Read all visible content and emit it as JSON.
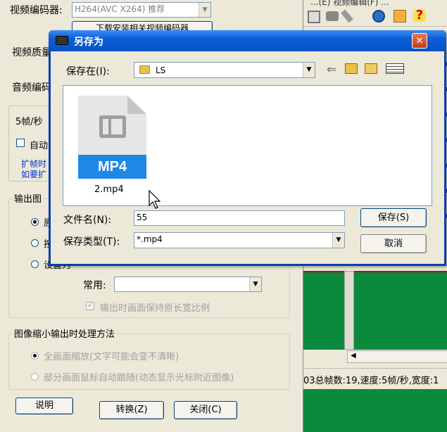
{
  "left_panel": {
    "video_codec_label": "视频编码器:",
    "video_codec_value": "H264(AVC X264) 推荐",
    "download_codec_button": "下载安装相关视频编码器",
    "video_quality_label": "视频质量",
    "audio_codec_label": "音频编码",
    "fps_label": "5帧/秒",
    "auto_checkbox_label": "自动",
    "expand_line1": "扩帧时",
    "expand_line2": "如要扩",
    "output_group_title": "输出图",
    "radio1_label": "原",
    "radio2_label": "按",
    "radio3_label": "设置为",
    "common_label": "常用:",
    "common_value": "",
    "keep_ratio_label": "输出时画面保持原长宽比例",
    "scale_group_title": "图像缩小输出时处理方法",
    "scale_option1": "全画面缩放(文字可能会变不清晰)",
    "scale_option2": "部分画面鼠标自动跟随(动态显示光标附近图像)",
    "help_button": "说明",
    "convert_button": "转换(Z)",
    "close_button": "关闭(C)"
  },
  "right_panel": {
    "menu_text": "...(E)  视频编辑(F)  ...",
    "status_text": "03总帧数:19,速度:5帧/秒,宽度:1",
    "preview_color": "#0b8a3e"
  },
  "dialog": {
    "title": "另存为",
    "close_glyph": "✕",
    "save_in_label": "保存在(I):",
    "save_in_value": "LS",
    "file": {
      "badge": "MP4",
      "name": "2.mp4"
    },
    "filename_label": "文件名(N):",
    "filename_value": "55",
    "filetype_label": "保存类型(T):",
    "filetype_value": "*.mp4",
    "save_button": "保存(S)",
    "cancel_button": "取消"
  },
  "colors": {
    "title_bar": "#0a5fd8",
    "mp4_badge": "#1e88e5",
    "folder": "#e8c14a"
  }
}
